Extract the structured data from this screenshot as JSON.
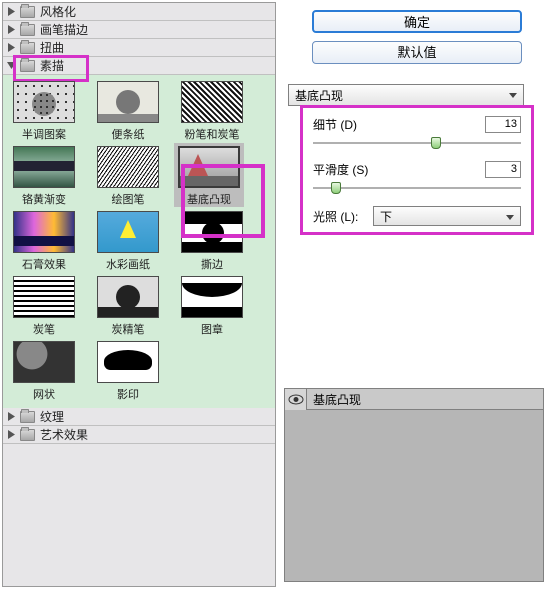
{
  "buttons": {
    "ok": "确定",
    "defaults": "默认值"
  },
  "main_filter_dd": "基底凸现",
  "categories": {
    "c0": "风格化",
    "c1": "画笔描边",
    "c2": "扭曲",
    "c3": "素描",
    "c4": "纹理",
    "c5": "艺术效果"
  },
  "thumbs": {
    "r0c0": "半调图案",
    "r0c1": "便条纸",
    "r0c2": "粉笔和炭笔",
    "r1c0": "铬黄渐变",
    "r1c1": "绘图笔",
    "r1c2": "基底凸现",
    "r2c0": "石膏效果",
    "r2c1": "水彩画纸",
    "r2c2": "撕边",
    "r3c0": "炭笔",
    "r3c1": "炭精笔",
    "r3c2": "图章",
    "r4c0": "网状",
    "r4c1": "影印"
  },
  "params": {
    "detail_label": "细节 (D)",
    "detail_value": "13",
    "smooth_label": "平滑度 (S)",
    "smooth_value": "3",
    "light_label": "光照 (L):",
    "light_value": "下"
  },
  "stack": {
    "layer0": "基底凸现"
  }
}
